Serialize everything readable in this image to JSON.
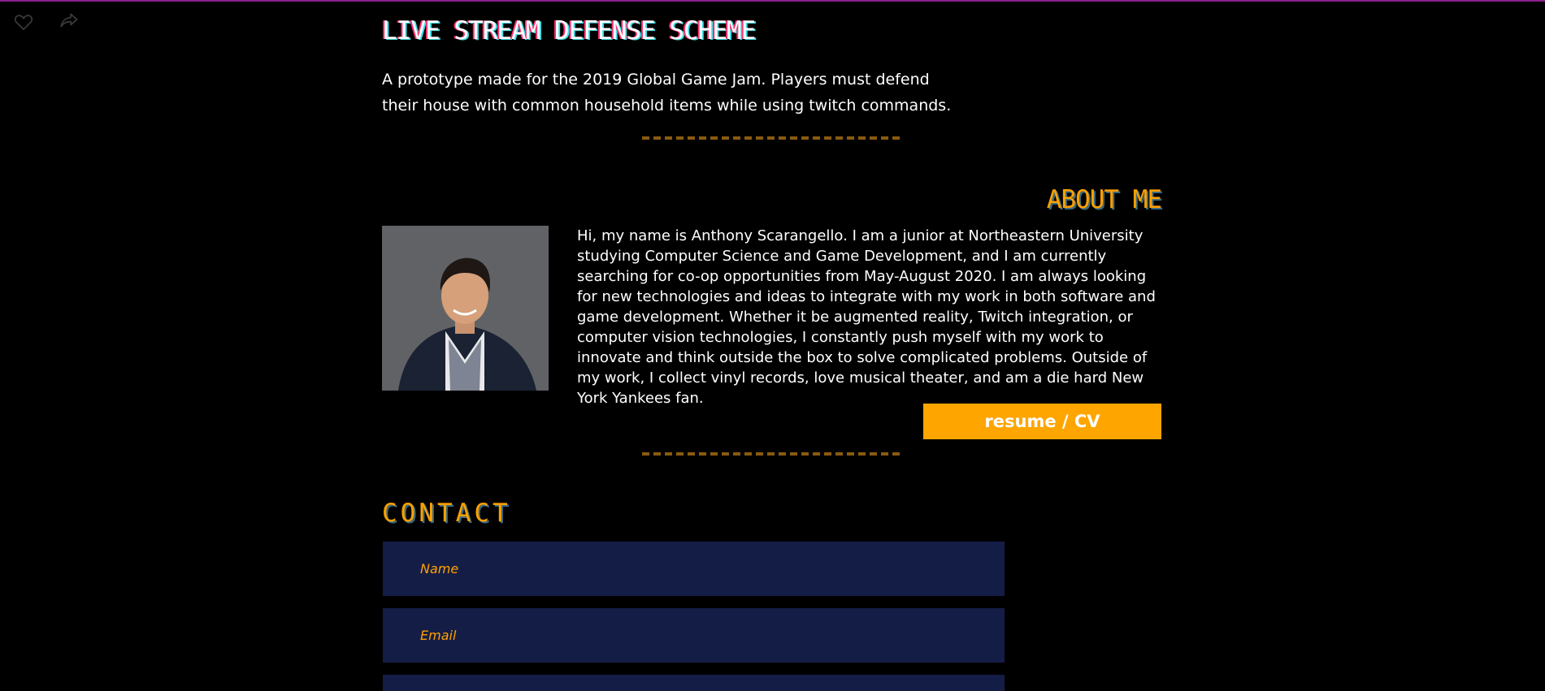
{
  "top_bar": {
    "icons": [
      "heart-icon",
      "share-icon"
    ],
    "accent_color": "#8a1f8a"
  },
  "project": {
    "title": "LIVE STREAM DEFENSE SCHEME",
    "description": "A prototype made for the 2019 Global Game Jam. Players must defend their house with common household items while using twitch commands."
  },
  "about": {
    "heading": "ABOUT ME",
    "bio": "Hi, my name is Anthony Scarangello. I am a junior at Northeastern University studying Computer Science and Game Development, and I am currently searching for co-op opportunities from May-August 2020. I am always looking for new technologies and ideas to integrate with my work in both software and game development. Whether it be augmented reality, Twitch integration, or computer vision technologies, I constantly push myself with my work to innovate and think outside the box to solve complicated problems. Outside of my work, I collect vinyl records, love musical theater, and am a die hard New York Yankees fan.",
    "resume_label": "resume / CV"
  },
  "contact": {
    "heading": "CONTACT",
    "name_placeholder": "Name",
    "email_placeholder": "Email"
  },
  "colors": {
    "background": "#000000",
    "accent": "#ffa500",
    "field_bg": "#141d45",
    "divider": "#8a5a10"
  }
}
